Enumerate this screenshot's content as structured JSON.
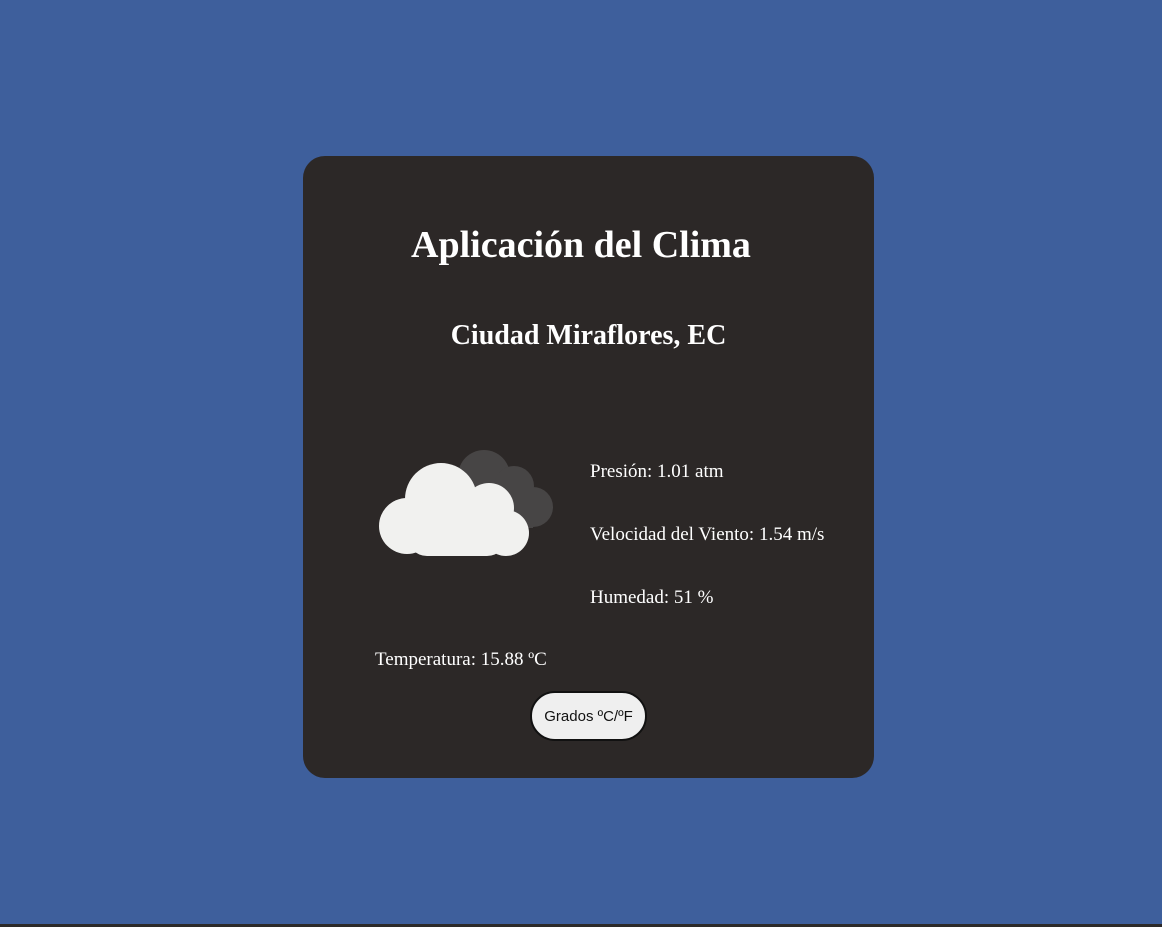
{
  "app": {
    "title": "Aplicación del Clima"
  },
  "location": "Ciudad Miraflores, EC",
  "weather": {
    "icon": "cloudy-icon",
    "pressure": "Presión: 1.01 atm",
    "wind": "Velocidad del Viento: 1.54 m/s",
    "humidity": "Humedad: 51 %",
    "temperature": "Temperatura: 15.88 ºC"
  },
  "controls": {
    "unit_toggle_label": "Grados ºC/ºF"
  },
  "colors": {
    "background": "#3e5f9c",
    "card": "#2c2827",
    "text": "#ffffff",
    "button": "#efefef"
  }
}
